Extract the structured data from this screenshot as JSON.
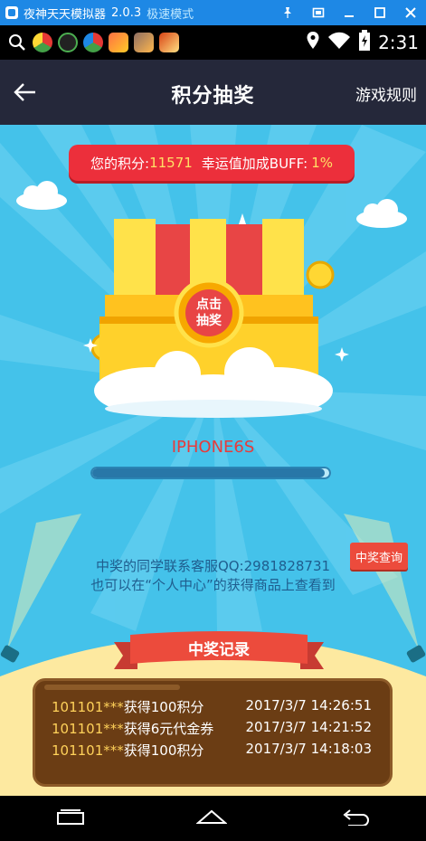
{
  "emulator": {
    "title": "夜神天天模拟器",
    "version": "2.0.3",
    "mode": "极速模式",
    "controls": [
      "pin",
      "fullscreen",
      "minimize",
      "maximize",
      "close"
    ]
  },
  "status_bar": {
    "time": "2:31",
    "apps": [
      "search-app",
      "chrome-app",
      "agent-app",
      "chrome-app-2",
      "game-app-1",
      "game-app-2",
      "game-app-3"
    ]
  },
  "header": {
    "title": "积分抽奖",
    "rules_label": "游戏规则"
  },
  "score": {
    "prefix": "您的积分:",
    "points": "11571",
    "buff_label": "幸运值加成BUFF:",
    "buff_value": "1%"
  },
  "chest": {
    "button_line1": "点击",
    "button_line2": "抽奖"
  },
  "prize": {
    "name": "IPHONE6S",
    "progress": 0.98
  },
  "contact": {
    "line1": "中奖的同学联系客服QQ:2981828731",
    "line2": "也可以在“个人中心”的获得商品上查看到"
  },
  "query_button": "中奖查询",
  "winners": {
    "title": "中奖记录",
    "rows": [
      {
        "uid": "101101***",
        "prize": "获得100积分",
        "time": "2017/3/7 14:26:51"
      },
      {
        "uid": "101101***",
        "prize": "获得6元代金券",
        "time": "2017/3/7 14:21:52"
      },
      {
        "uid": "101101***",
        "prize": "获得100积分",
        "time": "2017/3/7 14:18:03"
      }
    ]
  },
  "colors": {
    "emulator_bar": "#1e88e5",
    "header": "#25283a",
    "background": "#44c2ea",
    "score_pill": "#ec2f3b",
    "highlight": "#ffe066",
    "prize_text": "#e83b3b",
    "winner_panel": "#6b3d14",
    "winner_uid": "#ffd25a"
  }
}
